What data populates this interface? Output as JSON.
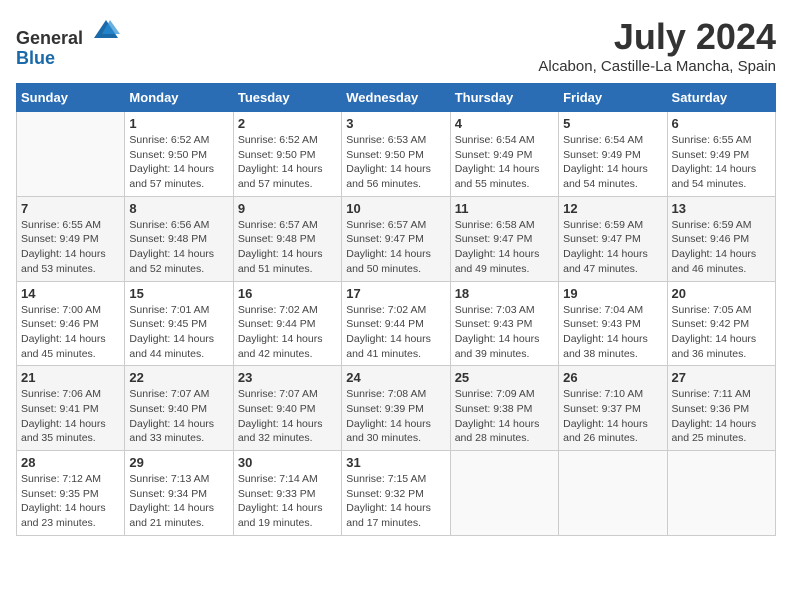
{
  "logo": {
    "text_general": "General",
    "text_blue": "Blue"
  },
  "title": "July 2024",
  "location": "Alcabon, Castille-La Mancha, Spain",
  "days_of_week": [
    "Sunday",
    "Monday",
    "Tuesday",
    "Wednesday",
    "Thursday",
    "Friday",
    "Saturday"
  ],
  "weeks": [
    [
      {
        "day": "",
        "sunrise": "",
        "sunset": "",
        "daylight": ""
      },
      {
        "day": "1",
        "sunrise": "Sunrise: 6:52 AM",
        "sunset": "Sunset: 9:50 PM",
        "daylight": "Daylight: 14 hours and 57 minutes."
      },
      {
        "day": "2",
        "sunrise": "Sunrise: 6:52 AM",
        "sunset": "Sunset: 9:50 PM",
        "daylight": "Daylight: 14 hours and 57 minutes."
      },
      {
        "day": "3",
        "sunrise": "Sunrise: 6:53 AM",
        "sunset": "Sunset: 9:50 PM",
        "daylight": "Daylight: 14 hours and 56 minutes."
      },
      {
        "day": "4",
        "sunrise": "Sunrise: 6:54 AM",
        "sunset": "Sunset: 9:49 PM",
        "daylight": "Daylight: 14 hours and 55 minutes."
      },
      {
        "day": "5",
        "sunrise": "Sunrise: 6:54 AM",
        "sunset": "Sunset: 9:49 PM",
        "daylight": "Daylight: 14 hours and 54 minutes."
      },
      {
        "day": "6",
        "sunrise": "Sunrise: 6:55 AM",
        "sunset": "Sunset: 9:49 PM",
        "daylight": "Daylight: 14 hours and 54 minutes."
      }
    ],
    [
      {
        "day": "7",
        "sunrise": "Sunrise: 6:55 AM",
        "sunset": "Sunset: 9:49 PM",
        "daylight": "Daylight: 14 hours and 53 minutes."
      },
      {
        "day": "8",
        "sunrise": "Sunrise: 6:56 AM",
        "sunset": "Sunset: 9:48 PM",
        "daylight": "Daylight: 14 hours and 52 minutes."
      },
      {
        "day": "9",
        "sunrise": "Sunrise: 6:57 AM",
        "sunset": "Sunset: 9:48 PM",
        "daylight": "Daylight: 14 hours and 51 minutes."
      },
      {
        "day": "10",
        "sunrise": "Sunrise: 6:57 AM",
        "sunset": "Sunset: 9:47 PM",
        "daylight": "Daylight: 14 hours and 50 minutes."
      },
      {
        "day": "11",
        "sunrise": "Sunrise: 6:58 AM",
        "sunset": "Sunset: 9:47 PM",
        "daylight": "Daylight: 14 hours and 49 minutes."
      },
      {
        "day": "12",
        "sunrise": "Sunrise: 6:59 AM",
        "sunset": "Sunset: 9:47 PM",
        "daylight": "Daylight: 14 hours and 47 minutes."
      },
      {
        "day": "13",
        "sunrise": "Sunrise: 6:59 AM",
        "sunset": "Sunset: 9:46 PM",
        "daylight": "Daylight: 14 hours and 46 minutes."
      }
    ],
    [
      {
        "day": "14",
        "sunrise": "Sunrise: 7:00 AM",
        "sunset": "Sunset: 9:46 PM",
        "daylight": "Daylight: 14 hours and 45 minutes."
      },
      {
        "day": "15",
        "sunrise": "Sunrise: 7:01 AM",
        "sunset": "Sunset: 9:45 PM",
        "daylight": "Daylight: 14 hours and 44 minutes."
      },
      {
        "day": "16",
        "sunrise": "Sunrise: 7:02 AM",
        "sunset": "Sunset: 9:44 PM",
        "daylight": "Daylight: 14 hours and 42 minutes."
      },
      {
        "day": "17",
        "sunrise": "Sunrise: 7:02 AM",
        "sunset": "Sunset: 9:44 PM",
        "daylight": "Daylight: 14 hours and 41 minutes."
      },
      {
        "day": "18",
        "sunrise": "Sunrise: 7:03 AM",
        "sunset": "Sunset: 9:43 PM",
        "daylight": "Daylight: 14 hours and 39 minutes."
      },
      {
        "day": "19",
        "sunrise": "Sunrise: 7:04 AM",
        "sunset": "Sunset: 9:43 PM",
        "daylight": "Daylight: 14 hours and 38 minutes."
      },
      {
        "day": "20",
        "sunrise": "Sunrise: 7:05 AM",
        "sunset": "Sunset: 9:42 PM",
        "daylight": "Daylight: 14 hours and 36 minutes."
      }
    ],
    [
      {
        "day": "21",
        "sunrise": "Sunrise: 7:06 AM",
        "sunset": "Sunset: 9:41 PM",
        "daylight": "Daylight: 14 hours and 35 minutes."
      },
      {
        "day": "22",
        "sunrise": "Sunrise: 7:07 AM",
        "sunset": "Sunset: 9:40 PM",
        "daylight": "Daylight: 14 hours and 33 minutes."
      },
      {
        "day": "23",
        "sunrise": "Sunrise: 7:07 AM",
        "sunset": "Sunset: 9:40 PM",
        "daylight": "Daylight: 14 hours and 32 minutes."
      },
      {
        "day": "24",
        "sunrise": "Sunrise: 7:08 AM",
        "sunset": "Sunset: 9:39 PM",
        "daylight": "Daylight: 14 hours and 30 minutes."
      },
      {
        "day": "25",
        "sunrise": "Sunrise: 7:09 AM",
        "sunset": "Sunset: 9:38 PM",
        "daylight": "Daylight: 14 hours and 28 minutes."
      },
      {
        "day": "26",
        "sunrise": "Sunrise: 7:10 AM",
        "sunset": "Sunset: 9:37 PM",
        "daylight": "Daylight: 14 hours and 26 minutes."
      },
      {
        "day": "27",
        "sunrise": "Sunrise: 7:11 AM",
        "sunset": "Sunset: 9:36 PM",
        "daylight": "Daylight: 14 hours and 25 minutes."
      }
    ],
    [
      {
        "day": "28",
        "sunrise": "Sunrise: 7:12 AM",
        "sunset": "Sunset: 9:35 PM",
        "daylight": "Daylight: 14 hours and 23 minutes."
      },
      {
        "day": "29",
        "sunrise": "Sunrise: 7:13 AM",
        "sunset": "Sunset: 9:34 PM",
        "daylight": "Daylight: 14 hours and 21 minutes."
      },
      {
        "day": "30",
        "sunrise": "Sunrise: 7:14 AM",
        "sunset": "Sunset: 9:33 PM",
        "daylight": "Daylight: 14 hours and 19 minutes."
      },
      {
        "day": "31",
        "sunrise": "Sunrise: 7:15 AM",
        "sunset": "Sunset: 9:32 PM",
        "daylight": "Daylight: 14 hours and 17 minutes."
      },
      {
        "day": "",
        "sunrise": "",
        "sunset": "",
        "daylight": ""
      },
      {
        "day": "",
        "sunrise": "",
        "sunset": "",
        "daylight": ""
      },
      {
        "day": "",
        "sunrise": "",
        "sunset": "",
        "daylight": ""
      }
    ]
  ]
}
